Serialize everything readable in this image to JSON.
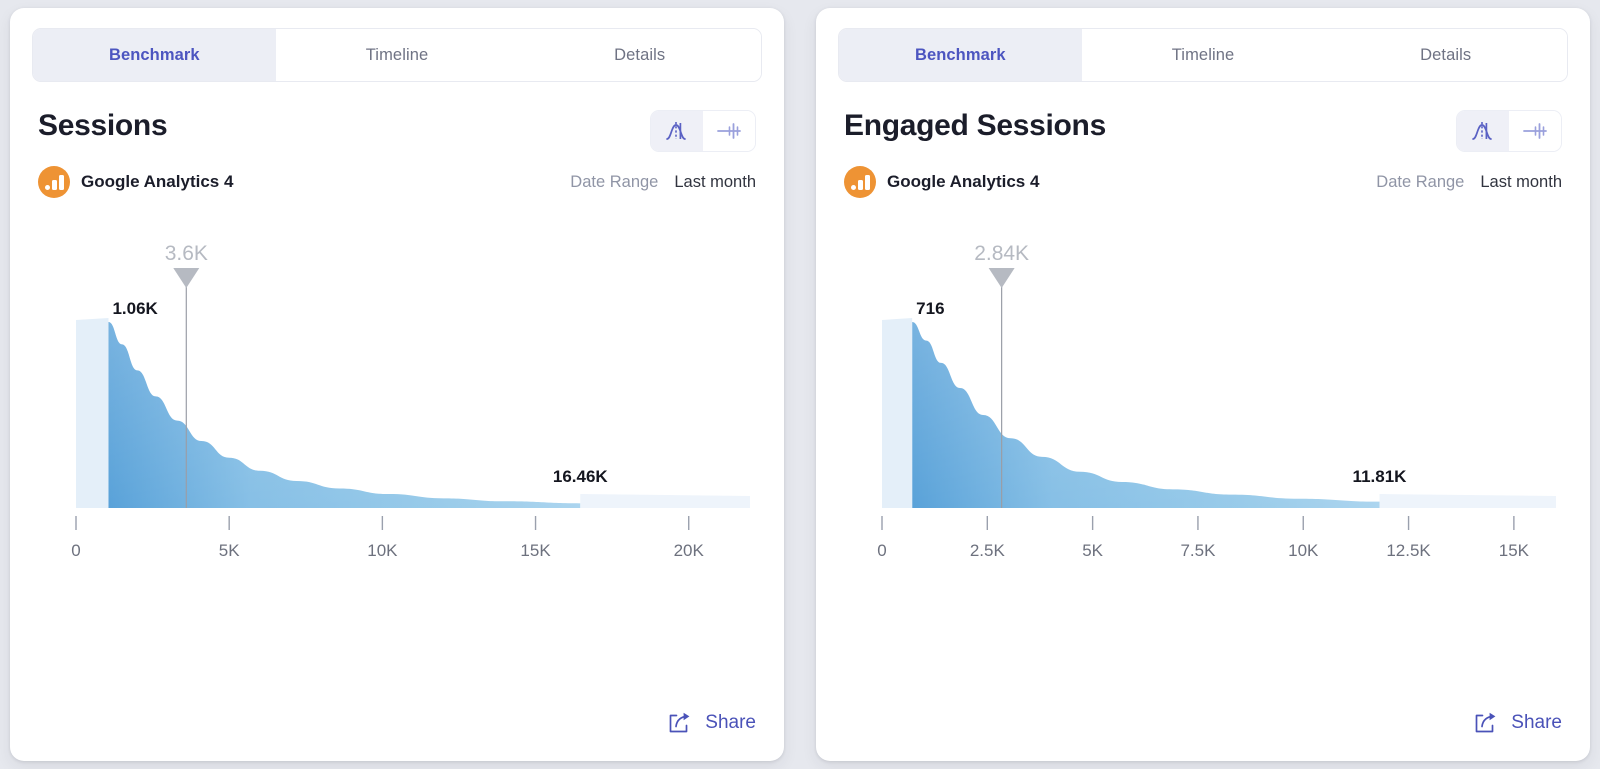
{
  "background_color": "#e6e8ee",
  "accent_color": "#4c55c0",
  "curve_color": "#63a9db",
  "source_icon_color": "#ee9334",
  "cards": [
    {
      "tabs": [
        {
          "label": "Benchmark",
          "active": true
        },
        {
          "label": "Timeline",
          "active": false
        },
        {
          "label": "Details",
          "active": false
        }
      ],
      "title": "Sessions",
      "view_toggle": [
        {
          "icon": "distribution-curve-icon",
          "active": true
        },
        {
          "icon": "box-plot-icon",
          "active": false
        }
      ],
      "source": {
        "icon": "google-analytics-icon",
        "name": "Google Analytics 4"
      },
      "date_range": {
        "label": "Date Range",
        "value": "Last month"
      },
      "share": {
        "icon": "share-icon",
        "label": "Share"
      },
      "chart_data": {
        "type": "area",
        "title": "Sessions",
        "xlabel": "",
        "ylabel": "",
        "grid": false,
        "legend": null,
        "xlim": [
          0,
          22000
        ],
        "ticks": [
          "0",
          "5K",
          "10K",
          "15K",
          "20K"
        ],
        "tick_values": [
          0,
          5000,
          10000,
          15000,
          20000
        ],
        "markers": [
          {
            "name": "benchmark-marker",
            "label": "3.6K",
            "value": 3600,
            "style": "gray-triangle-line"
          },
          {
            "name": "peak-label",
            "label": "1.06K",
            "value": 1060,
            "style": "peak-annotation"
          },
          {
            "name": "range-end-label",
            "label": "16.46K",
            "value": 16460,
            "style": "fill-end-annotation"
          }
        ],
        "x": [
          1060,
          1500,
          2000,
          2600,
          3300,
          4100,
          5000,
          6000,
          7200,
          8600,
          10200,
          12000,
          14000,
          16460,
          19000,
          22000
        ],
        "y": [
          1.0,
          0.88,
          0.74,
          0.6,
          0.47,
          0.36,
          0.27,
          0.2,
          0.145,
          0.105,
          0.075,
          0.052,
          0.036,
          0.025,
          0.018,
          0.012
        ],
        "peak_x": 1060,
        "fill_end_x": 16460,
        "tail_start_x": 16460
      }
    },
    {
      "tabs": [
        {
          "label": "Benchmark",
          "active": true
        },
        {
          "label": "Timeline",
          "active": false
        },
        {
          "label": "Details",
          "active": false
        }
      ],
      "title": "Engaged Sessions",
      "view_toggle": [
        {
          "icon": "distribution-curve-icon",
          "active": true
        },
        {
          "icon": "box-plot-icon",
          "active": false
        }
      ],
      "source": {
        "icon": "google-analytics-icon",
        "name": "Google Analytics 4"
      },
      "date_range": {
        "label": "Date Range",
        "value": "Last month"
      },
      "share": {
        "icon": "share-icon",
        "label": "Share"
      },
      "chart_data": {
        "type": "area",
        "title": "Engaged Sessions",
        "xlabel": "",
        "ylabel": "",
        "grid": false,
        "legend": null,
        "xlim": [
          0,
          16000
        ],
        "ticks": [
          "0",
          "2.5K",
          "5K",
          "7.5K",
          "10K",
          "12.5K",
          "15K"
        ],
        "tick_values": [
          0,
          2500,
          5000,
          7500,
          10000,
          12500,
          15000
        ],
        "markers": [
          {
            "name": "benchmark-marker",
            "label": "2.84K",
            "value": 2840,
            "style": "gray-triangle-line"
          },
          {
            "name": "peak-label",
            "label": "716",
            "value": 716,
            "style": "peak-annotation"
          },
          {
            "name": "range-end-label",
            "label": "11.81K",
            "value": 11810,
            "style": "fill-end-annotation"
          }
        ],
        "x": [
          716,
          1050,
          1400,
          1850,
          2400,
          3050,
          3800,
          4700,
          5700,
          6900,
          8300,
          9900,
          11810,
          13500,
          16000
        ],
        "y": [
          1.0,
          0.9,
          0.78,
          0.645,
          0.5,
          0.375,
          0.275,
          0.195,
          0.14,
          0.1,
          0.072,
          0.05,
          0.034,
          0.024,
          0.015
        ],
        "peak_x": 716,
        "fill_end_x": 11810,
        "tail_start_x": 11810
      }
    }
  ]
}
